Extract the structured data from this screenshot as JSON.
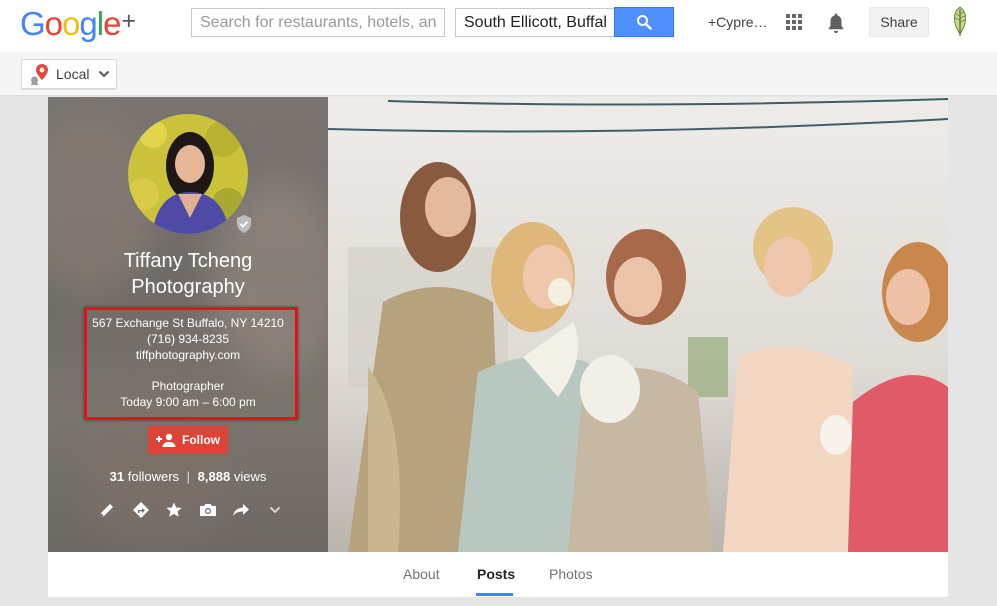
{
  "header": {
    "logo_text": "Google",
    "logo_plus": "+",
    "logo_colors": [
      "#4285f4",
      "#ea4335",
      "#fbbc05",
      "#4285f4",
      "#34a853",
      "#ea4335"
    ],
    "search_placeholder": "Search for restaurants, hotels, and more",
    "location_value": "South Ellicott, Buffalo",
    "user_link": "+Cypre…",
    "share_label": "Share"
  },
  "subbar": {
    "local_label": "Local"
  },
  "profile": {
    "name_line1": "Tiffany Tcheng",
    "name_line2": "Photography",
    "address": "567 Exchange St Buffalo, NY 14210",
    "phone": "(716) 934-8235",
    "website": "tiffphotography.com",
    "category": "Photographer",
    "hours": "Today 9:00 am – 6:00 pm",
    "follow_label": "Follow",
    "followers_count": "31",
    "followers_label": "followers",
    "separator": "|",
    "views_count": "8,888",
    "views_label": "views",
    "action_icons": [
      "pencil-icon",
      "directions-icon",
      "star-icon",
      "camera-icon",
      "share-arrow-icon",
      "chevron-down-icon"
    ]
  },
  "tabs": [
    {
      "label": "About",
      "active": false
    },
    {
      "label": "Posts",
      "active": true
    },
    {
      "label": "Photos",
      "active": false
    }
  ],
  "colors": {
    "accent_blue": "#4d90fe",
    "follow_red": "#db4437",
    "highlight_red": "#e3121b",
    "tab_underline": "#4285f4"
  }
}
